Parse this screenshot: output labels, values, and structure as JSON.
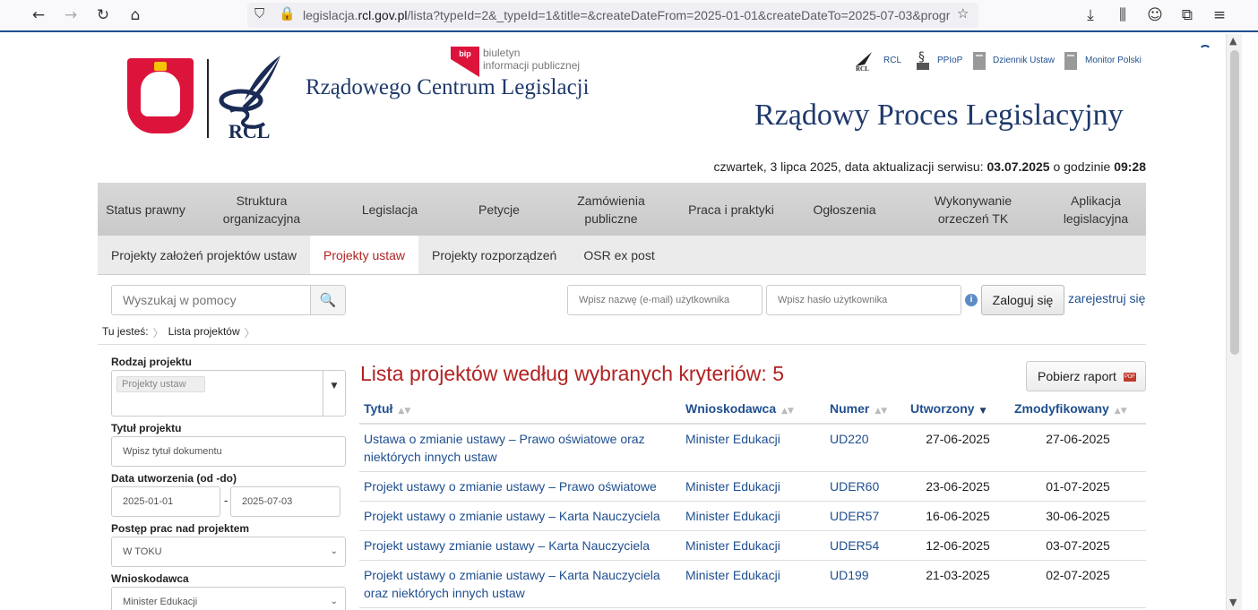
{
  "browser": {
    "url_prefix": "legislacja.",
    "url_domain": "rcl.gov.pl",
    "url_rest": "/lista?typeId=2&_typeId=1&title=&createDateFrom=2025-01-01&createDateTo=2025-07-03&progr"
  },
  "header": {
    "bip_line1": "biuletyn",
    "bip_line2": "informacji publicznej",
    "bip_badge": "bip",
    "site_title": "Rządowego Centrum Legislacji",
    "rcl_logo_text": "RCL",
    "big_title": "Rządowy Proces Legislacyjny",
    "top_links": [
      "RCL",
      "PPIoP",
      "Dziennik Ustaw",
      "Monitor Polski"
    ],
    "date_text": "czwartek, 3 lipca 2025, data aktualizacji serwisu: ",
    "date_update": "03.07.2025",
    "date_mid": " o godzinie ",
    "date_time": "09:28"
  },
  "main_nav": [
    "Status prawny",
    "Struktura organizacyjna",
    "Legislacja",
    "Petycje",
    "Zamówienia publiczne",
    "Praca i praktyki",
    "Ogłoszenia",
    "Wykonywanie orzeczeń TK",
    "Aplikacja legislacyjna"
  ],
  "sub_nav": [
    "Projekty założeń projektów ustaw",
    "Projekty ustaw",
    "Projekty rozporządzeń",
    "OSR ex post"
  ],
  "search": {
    "help_placeholder": "Wyszukaj w pomocy",
    "login_placeholder": "Wpisz nazwę (e-mail) użytkownika",
    "password_placeholder": "Wpisz hasło użytkownika",
    "login_button": "Zaloguj się",
    "register_link": "zarejestruj się",
    "info_icon_glyph": "i",
    "search_icon_glyph": "🔍"
  },
  "breadcrumb": {
    "prefix": "Tu jesteś:",
    "current": "Lista projektów"
  },
  "filters": {
    "type_label": "Rodzaj projektu",
    "type_value": "Projekty ustaw",
    "title_label": "Tytuł projektu",
    "title_placeholder": "Wpisz tytuł dokumentu",
    "date_label": "Data utworzenia (od -do)",
    "date_from": "2025-01-01",
    "date_to": "2025-07-03",
    "progress_label": "Postęp prac nad projektem",
    "progress_value": "W TOKU",
    "applicant_label": "Wnioskodawca",
    "applicant_value": "Minister Edukacji"
  },
  "results": {
    "title": "Lista projektów według wybranych kryteriów: 5",
    "report_button": "Pobierz raport",
    "pdf_badge": "PDF",
    "columns": [
      "Tytuł",
      "Wnioskodawca",
      "Numer",
      "Utworzony",
      "Zmodyfikowany"
    ],
    "rows": [
      [
        "Ustawa o zmianie ustawy – Prawo oświatowe oraz niektórych innych ustaw",
        "Minister Edukacji",
        "UD220",
        "27-06-2025",
        "27-06-2025"
      ],
      [
        "Projekt ustawy o zmianie ustawy – Prawo oświatowe",
        "Minister Edukacji",
        "UDER60",
        "23-06-2025",
        "01-07-2025"
      ],
      [
        "Projekt ustawy o zmianie ustawy – Karta Nauczyciela",
        "Minister Edukacji",
        "UDER57",
        "16-06-2025",
        "30-06-2025"
      ],
      [
        "Projekt ustawy zmianie ustawy – Karta Nauczyciela",
        "Minister Edukacji",
        "UDER54",
        "12-06-2025",
        "03-07-2025"
      ],
      [
        "Projekt ustawy o zmianie ustawy – Karta Nauczyciela oraz niektórych innych ustaw",
        "Minister Edukacji",
        "UD199",
        "21-03-2025",
        "02-07-2025"
      ]
    ]
  },
  "colors": {
    "accent": "#1f4f8f",
    "title_red": "#b22222",
    "nav_bg": "#d0d0d0"
  }
}
